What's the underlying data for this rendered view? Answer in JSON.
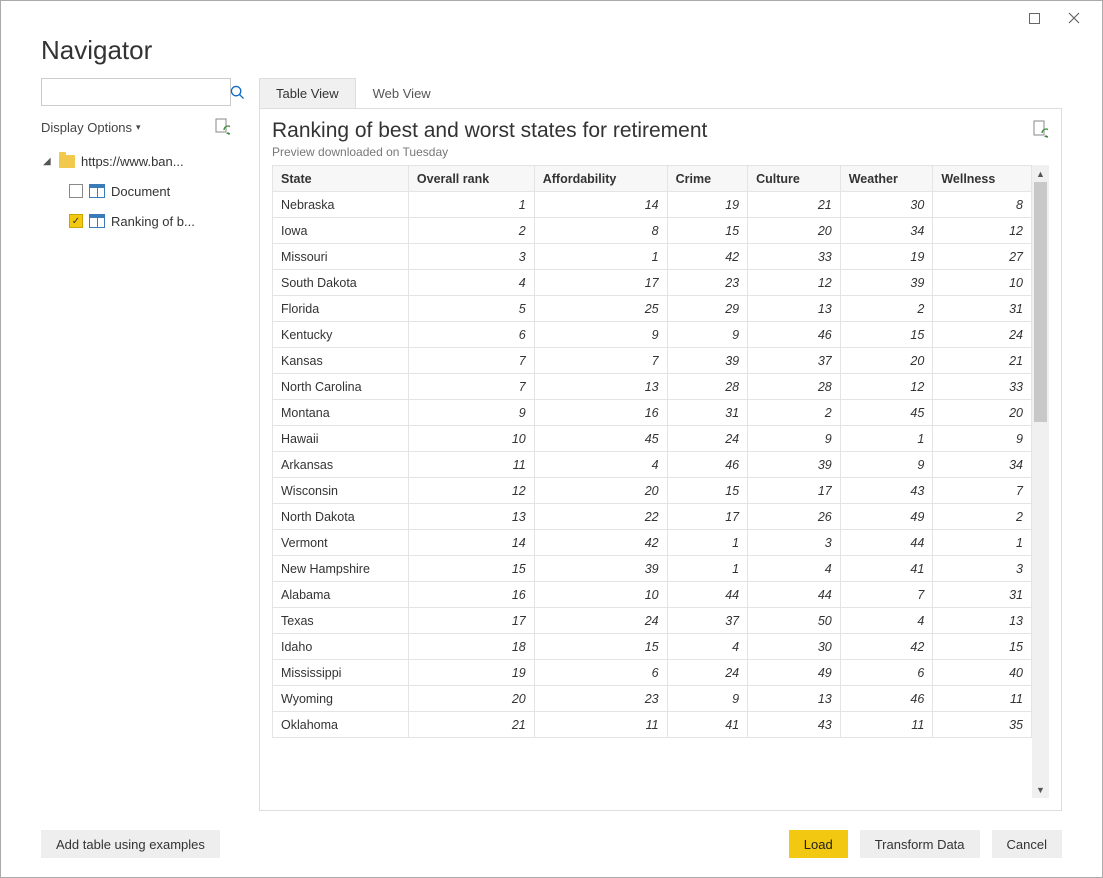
{
  "window_title": "Navigator",
  "search": {
    "placeholder": ""
  },
  "display_options_label": "Display Options",
  "tree": {
    "root_label": "https://www.ban...",
    "items": [
      {
        "label": "Document",
        "checked": false
      },
      {
        "label": "Ranking of b...",
        "checked": true
      }
    ]
  },
  "tabs": [
    {
      "label": "Table View",
      "active": true
    },
    {
      "label": "Web View",
      "active": false
    }
  ],
  "preview": {
    "title": "Ranking of best and worst states for retirement",
    "subtitle": "Preview downloaded on Tuesday"
  },
  "table": {
    "columns": [
      "State",
      "Overall rank",
      "Affordability",
      "Crime",
      "Culture",
      "Weather",
      "Wellness"
    ],
    "rows": [
      [
        "Nebraska",
        1,
        14,
        19,
        21,
        30,
        8
      ],
      [
        "Iowa",
        2,
        8,
        15,
        20,
        34,
        12
      ],
      [
        "Missouri",
        3,
        1,
        42,
        33,
        19,
        27
      ],
      [
        "South Dakota",
        4,
        17,
        23,
        12,
        39,
        10
      ],
      [
        "Florida",
        5,
        25,
        29,
        13,
        2,
        31
      ],
      [
        "Kentucky",
        6,
        9,
        9,
        46,
        15,
        24
      ],
      [
        "Kansas",
        7,
        7,
        39,
        37,
        20,
        21
      ],
      [
        "North Carolina",
        7,
        13,
        28,
        28,
        12,
        33
      ],
      [
        "Montana",
        9,
        16,
        31,
        2,
        45,
        20
      ],
      [
        "Hawaii",
        10,
        45,
        24,
        9,
        1,
        9
      ],
      [
        "Arkansas",
        11,
        4,
        46,
        39,
        9,
        34
      ],
      [
        "Wisconsin",
        12,
        20,
        15,
        17,
        43,
        7
      ],
      [
        "North Dakota",
        13,
        22,
        17,
        26,
        49,
        2
      ],
      [
        "Vermont",
        14,
        42,
        1,
        3,
        44,
        1
      ],
      [
        "New Hampshire",
        15,
        39,
        1,
        4,
        41,
        3
      ],
      [
        "Alabama",
        16,
        10,
        44,
        44,
        7,
        31
      ],
      [
        "Texas",
        17,
        24,
        37,
        50,
        4,
        13
      ],
      [
        "Idaho",
        18,
        15,
        4,
        30,
        42,
        15
      ],
      [
        "Mississippi",
        19,
        6,
        24,
        49,
        6,
        40
      ],
      [
        "Wyoming",
        20,
        23,
        9,
        13,
        46,
        11
      ],
      [
        "Oklahoma",
        21,
        11,
        41,
        43,
        11,
        35
      ]
    ]
  },
  "buttons": {
    "add_examples": "Add table using examples",
    "load": "Load",
    "transform": "Transform Data",
    "cancel": "Cancel"
  }
}
